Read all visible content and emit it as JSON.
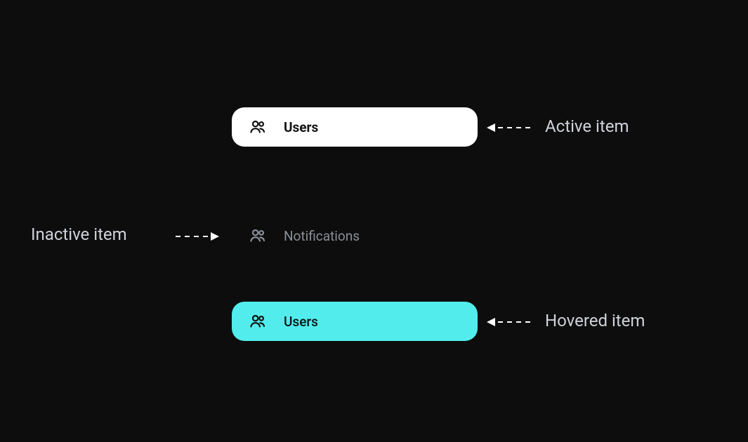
{
  "items": {
    "active": {
      "label": "Users",
      "icon": "users-icon"
    },
    "inactive": {
      "label": "Notifications",
      "icon": "users-icon"
    },
    "hovered": {
      "label": "Users",
      "icon": "users-icon"
    }
  },
  "annotations": {
    "active": "Active item",
    "inactive": "Inactive item",
    "hovered": "Hovered item"
  },
  "colors": {
    "background": "#0d0d0d",
    "active_bg": "#ffffff",
    "hover_bg": "#52ecec",
    "inactive_fg": "#8a8f98",
    "anno_fg": "#cfd3da"
  }
}
